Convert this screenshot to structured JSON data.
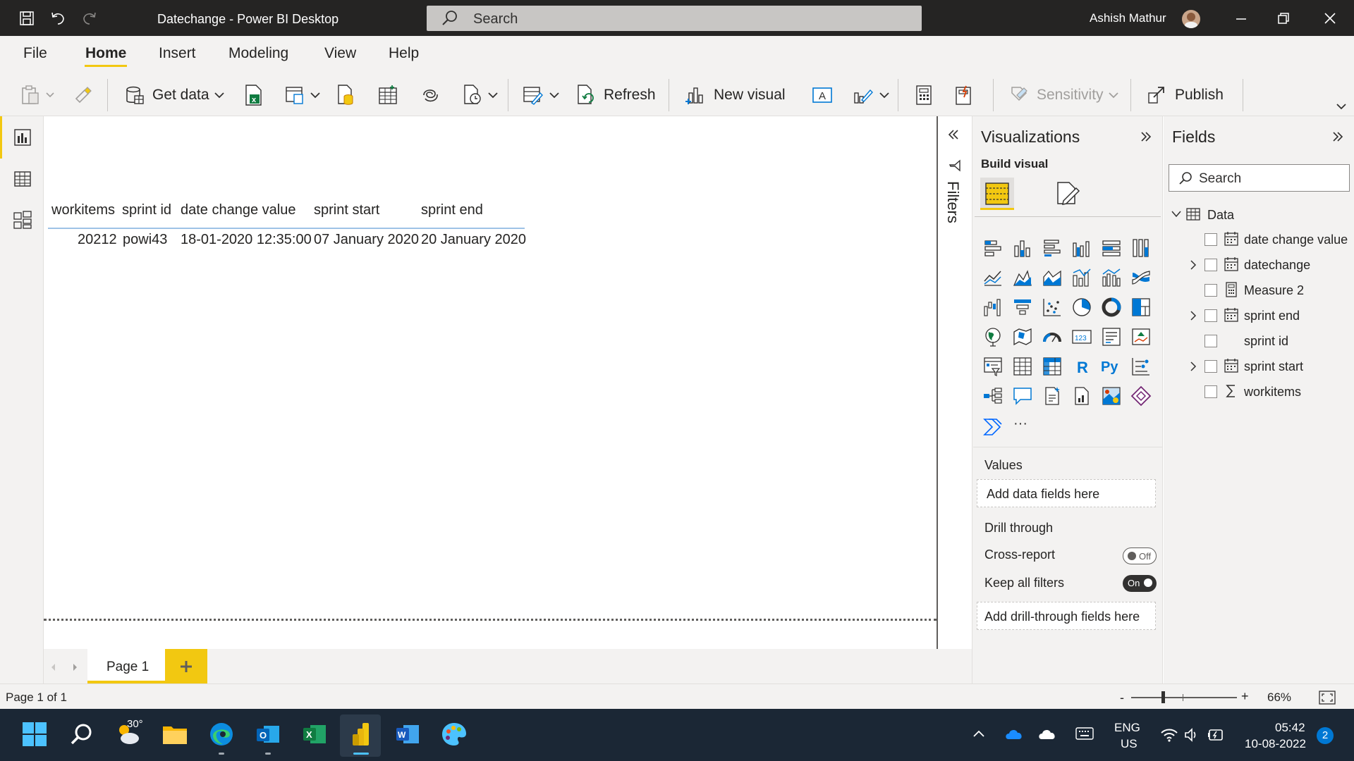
{
  "titlebar": {
    "title": "Datechange - Power BI Desktop",
    "search_placeholder": "Search",
    "user_name": "Ashish Mathur"
  },
  "menu": {
    "tabs": [
      "File",
      "Home",
      "Insert",
      "Modeling",
      "View",
      "Help"
    ],
    "active": "Home"
  },
  "ribbon": {
    "get_data": "Get data",
    "refresh": "Refresh",
    "new_visual": "New visual",
    "sensitivity": "Sensitivity",
    "publish": "Publish"
  },
  "table": {
    "headers": [
      "workitems",
      "sprint id",
      "date change value",
      "sprint start",
      "sprint end"
    ],
    "row": [
      "20212",
      "powi43",
      "18-01-2020 12:35:00",
      "07 January 2020",
      "20 January 2020"
    ]
  },
  "pages": {
    "current": "Page 1",
    "add_icon": "plus-icon",
    "count_text": "Page 1 of 1"
  },
  "filters": {
    "label": "Filters"
  },
  "visualizations": {
    "title": "Visualizations",
    "build_visual": "Build visual",
    "values_label": "Values",
    "values_well": "Add data fields here",
    "drill_through": "Drill through",
    "cross_report": "Cross-report",
    "cross_report_state": "Off",
    "keep_filters": "Keep all filters",
    "keep_filters_state": "On",
    "drill_well": "Add drill-through fields here",
    "more": "···"
  },
  "fields": {
    "title": "Fields",
    "search_placeholder": "Search",
    "table_name": "Data",
    "items": [
      {
        "label": "date change value",
        "icon": "calendar-icon",
        "expandable": false
      },
      {
        "label": "datechange",
        "icon": "calendar-icon",
        "expandable": true
      },
      {
        "label": "Measure 2",
        "icon": "calculator-icon",
        "expandable": false
      },
      {
        "label": "sprint end",
        "icon": "calendar-icon",
        "expandable": true
      },
      {
        "label": "sprint id",
        "icon": "",
        "expandable": false
      },
      {
        "label": "sprint start",
        "icon": "calendar-icon",
        "expandable": true
      },
      {
        "label": "workitems",
        "icon": "sigma-icon",
        "expandable": false
      }
    ]
  },
  "status": {
    "zoom": "66%"
  },
  "taskbar": {
    "weather": "30°",
    "lang_line1": "ENG",
    "lang_line2": "US",
    "time": "05:42",
    "date": "10-08-2022",
    "notifications": "2"
  },
  "colors": {
    "accent": "#f2c811",
    "titlebar": "#252423",
    "taskbar": "#1b2735"
  }
}
